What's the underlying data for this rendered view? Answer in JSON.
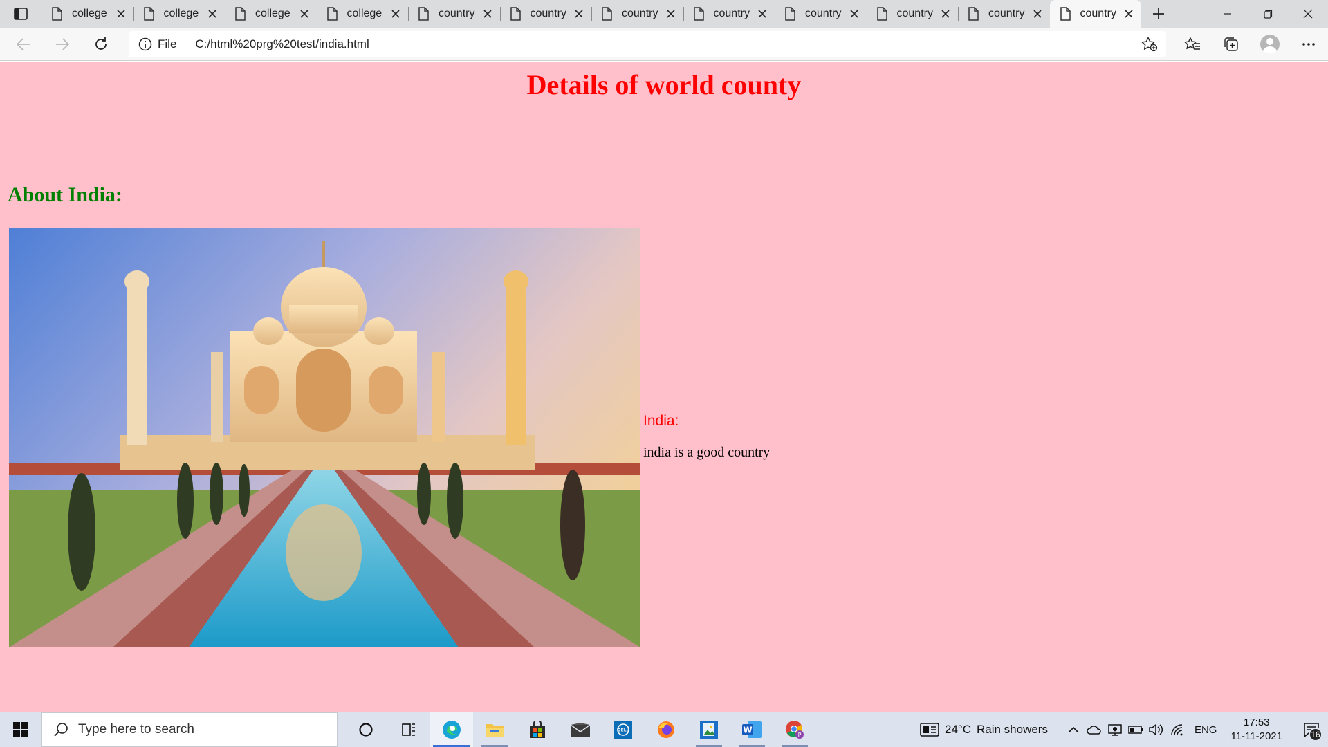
{
  "browser": {
    "tabs": [
      {
        "title": "college"
      },
      {
        "title": "college"
      },
      {
        "title": "college"
      },
      {
        "title": "college"
      },
      {
        "title": "country"
      },
      {
        "title": "country"
      },
      {
        "title": "country"
      },
      {
        "title": "country"
      },
      {
        "title": "country"
      },
      {
        "title": "country"
      },
      {
        "title": "country"
      },
      {
        "title": "country",
        "active": true
      }
    ],
    "address": {
      "scheme_label": "File",
      "url": "C:/html%20prg%20test/india.html"
    }
  },
  "page": {
    "heading": "Details of world county",
    "subheading": "About India:",
    "caption_title": "India:",
    "caption_text": "india is a good country",
    "background_color": "#ffc0cb",
    "heading_color": "#ff0000",
    "subheading_color": "#008000"
  },
  "taskbar": {
    "search_placeholder": "Type here to search",
    "weather": {
      "temperature": "24°C",
      "condition": "Rain showers"
    },
    "language": "ENG",
    "clock": {
      "time": "17:53",
      "date": "11-11-2021"
    },
    "notification_count": "16"
  }
}
